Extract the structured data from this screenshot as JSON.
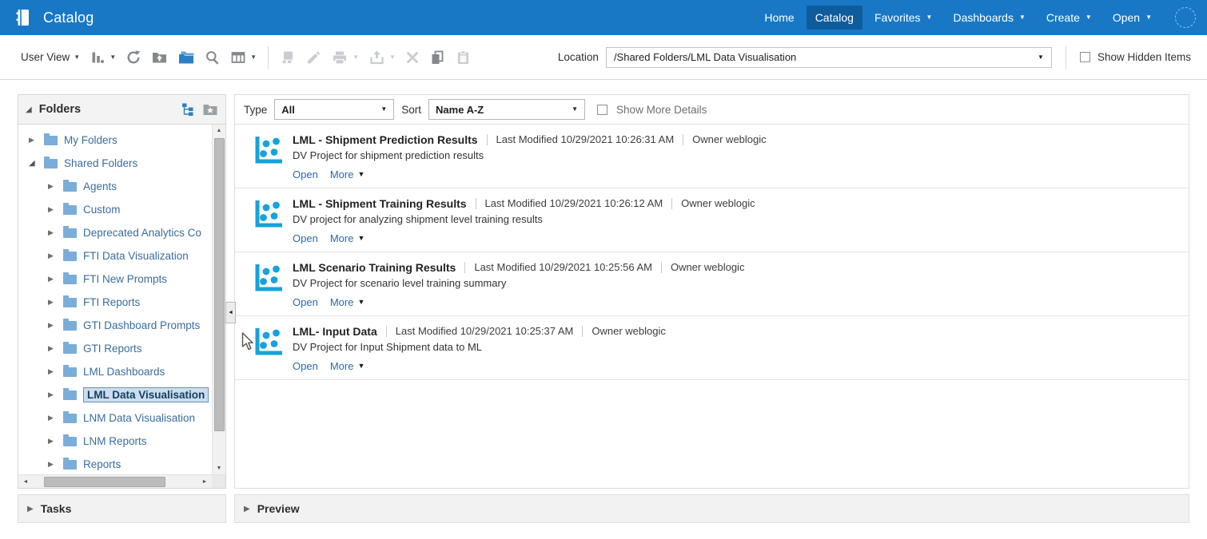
{
  "colors": {
    "header_blue": "#1878c6",
    "active_nav_blue": "#0f5c9c",
    "accent_blue": "#2d7fc4",
    "dv_project_icon_blue": "#14a3dc",
    "link_blue": "#2a6ba8",
    "folder_blue": "#7aadda",
    "selected_tree_bg": "#cdddee"
  },
  "icons": {
    "caret_down": "▼",
    "collapsed_triangle": "▶",
    "expanded_triangle": "◢",
    "scroll_up": "▲",
    "scroll_down": "▼",
    "scroll_left": "◄",
    "scroll_right": "►",
    "splitter_collapse": "◄"
  },
  "header": {
    "app_title": "Catalog",
    "nav_items": [
      {
        "label": "Home",
        "active": false,
        "has_dropdown": false
      },
      {
        "label": "Catalog",
        "active": true,
        "has_dropdown": false
      },
      {
        "label": "Favorites",
        "active": false,
        "has_dropdown": true
      },
      {
        "label": "Dashboards",
        "active": false,
        "has_dropdown": true
      },
      {
        "label": "Create",
        "active": false,
        "has_dropdown": true
      },
      {
        "label": "Open",
        "active": false,
        "has_dropdown": true
      }
    ]
  },
  "toolbar": {
    "view_selector_label": "User View",
    "location_label": "Location",
    "location_value": "/Shared Folders/LML Data Visualisation",
    "show_hidden_items_label": "Show Hidden Items"
  },
  "folders_panel": {
    "title": "Folders",
    "tree": [
      {
        "label": "My Folders",
        "level": 0,
        "expanded": false,
        "selected": false
      },
      {
        "label": "Shared Folders",
        "level": 0,
        "expanded": true,
        "selected": false
      },
      {
        "label": "Agents",
        "level": 1,
        "expanded": false,
        "selected": false
      },
      {
        "label": "Custom",
        "level": 1,
        "expanded": false,
        "selected": false
      },
      {
        "label": "Deprecated Analytics Co",
        "level": 1,
        "expanded": false,
        "selected": false
      },
      {
        "label": "FTI Data Visualization",
        "level": 1,
        "expanded": false,
        "selected": false
      },
      {
        "label": "FTI New Prompts",
        "level": 1,
        "expanded": false,
        "selected": false
      },
      {
        "label": "FTI Reports",
        "level": 1,
        "expanded": false,
        "selected": false
      },
      {
        "label": "GTI Dashboard Prompts",
        "level": 1,
        "expanded": false,
        "selected": false
      },
      {
        "label": "GTI Reports",
        "level": 1,
        "expanded": false,
        "selected": false
      },
      {
        "label": "LML Dashboards",
        "level": 1,
        "expanded": false,
        "selected": false
      },
      {
        "label": "LML Data Visualisation",
        "level": 1,
        "expanded": false,
        "selected": true
      },
      {
        "label": "LNM Data Visualisation",
        "level": 1,
        "expanded": false,
        "selected": false
      },
      {
        "label": "LNM Reports",
        "level": 1,
        "expanded": false,
        "selected": false
      },
      {
        "label": "Reports",
        "level": 1,
        "expanded": false,
        "selected": false
      }
    ],
    "tasks_label": "Tasks"
  },
  "content": {
    "type_label": "Type",
    "type_value": "All",
    "sort_label": "Sort",
    "sort_value": "Name A-Z",
    "show_more_details_label": "Show More Details",
    "actions": {
      "open": "Open",
      "more": "More"
    },
    "items": [
      {
        "title": "LML - Shipment Prediction Results",
        "last_modified": "Last Modified 10/29/2021 10:26:31 AM",
        "owner": "Owner weblogic",
        "description": "DV Project for shipment prediction results"
      },
      {
        "title": "LML - Shipment Training Results",
        "last_modified": "Last Modified 10/29/2021 10:26:12 AM",
        "owner": "Owner weblogic",
        "description": "DV project for analyzing shipment level training results"
      },
      {
        "title": "LML Scenario Training Results",
        "last_modified": "Last Modified 10/29/2021 10:25:56 AM",
        "owner": "Owner weblogic",
        "description": "DV Project for scenario level training summary"
      },
      {
        "title": "LML- Input Data",
        "last_modified": "Last Modified 10/29/2021 10:25:37 AM",
        "owner": "Owner weblogic",
        "description": "DV Project for Input Shipment data to ML"
      }
    ],
    "preview_label": "Preview"
  }
}
